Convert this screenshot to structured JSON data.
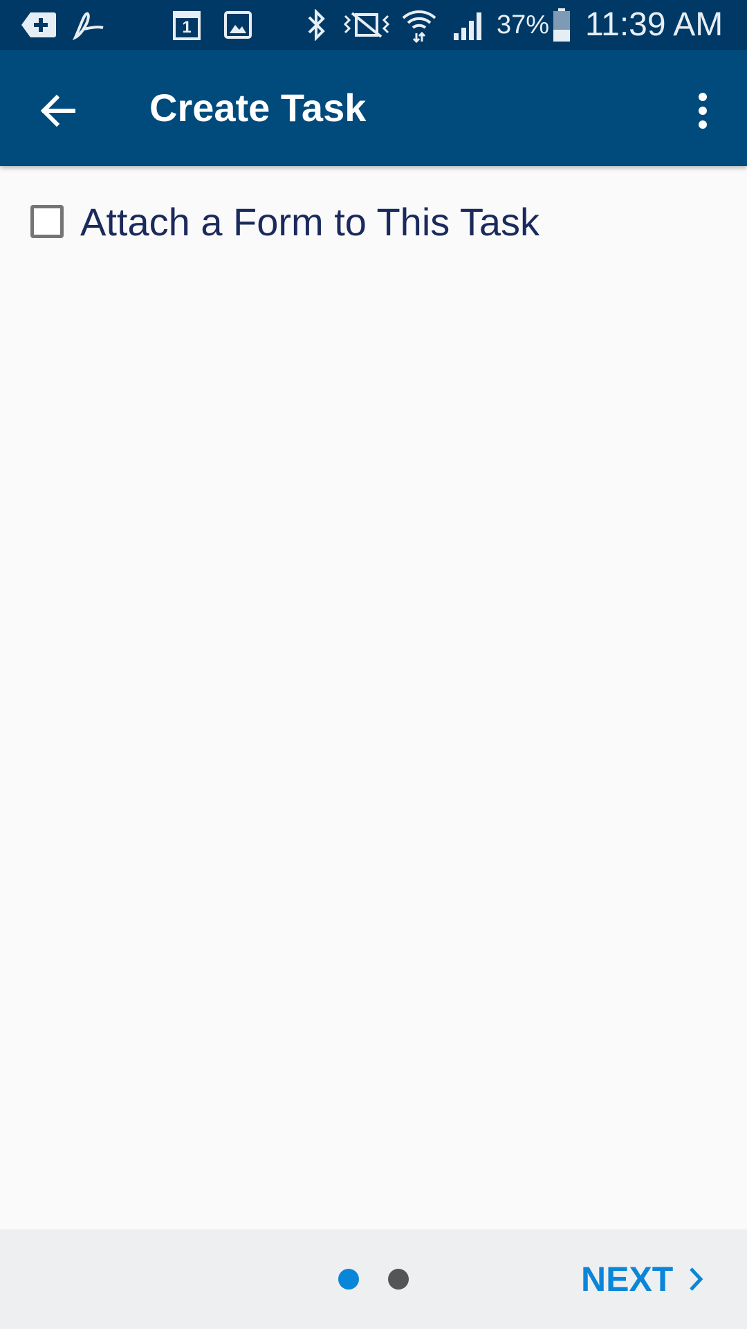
{
  "status_bar": {
    "battery_percent": "37%",
    "time": "11:39 AM",
    "icons": [
      "add-tag-icon",
      "acrobat-icon",
      "calendar-icon",
      "image-icon",
      "bluetooth-icon",
      "vibrate-icon",
      "wifi-icon",
      "signal-icon",
      "battery-icon"
    ],
    "calendar_day": "1"
  },
  "app_bar": {
    "title": "Create Task",
    "back_icon": "arrow-back-icon",
    "menu_icon": "more-vert-icon"
  },
  "form": {
    "attach_form_label": "Attach a Form to This Task",
    "attach_form_checked": false
  },
  "pager": {
    "page_count": 2,
    "current_page": 1,
    "next_label": "NEXT"
  },
  "colors": {
    "status_bar": "#003965",
    "app_bar": "#004a7c",
    "accent": "#0a86d8",
    "label_text": "#1b2a5c"
  }
}
